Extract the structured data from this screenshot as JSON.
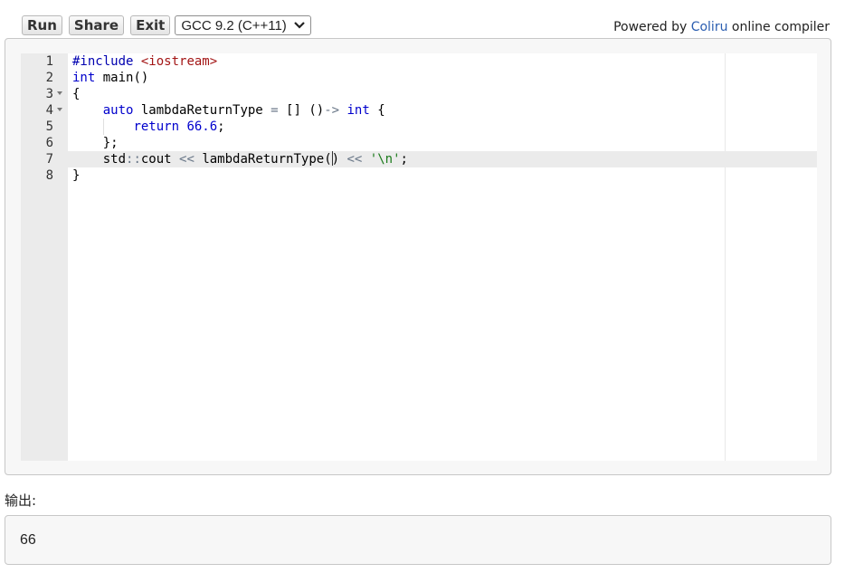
{
  "toolbar": {
    "run_label": "Run",
    "share_label": "Share",
    "exit_label": "Exit",
    "compiler_select": "GCC 9.2 (C++11)"
  },
  "powered_by": {
    "prefix": "Powered by",
    "link": "Coliru",
    "suffix": "online compiler"
  },
  "editor": {
    "active_line": 7,
    "line_numbers": [
      "1",
      "2",
      "3",
      "4",
      "5",
      "6",
      "7",
      "8"
    ],
    "lines": {
      "l1": {
        "directive": "#include",
        "header": "<iostream>"
      },
      "l2": {
        "type": "int",
        "rest": "main()"
      },
      "l3": {
        "text": "{"
      },
      "l4": {
        "kw_auto": "auto",
        "name": "lambdaReturnType",
        "eq": "=",
        "capture": "[]",
        "params": "()",
        "arrow": "->",
        "ret_type": "int",
        "brace": "{"
      },
      "l5": {
        "kw_return": "return",
        "number": "66.6",
        "semi": ";"
      },
      "l6": {
        "text": "};"
      },
      "l7": {
        "stream": "std",
        "scope": "::",
        "cout": "cout",
        "shift1": "<<",
        "call_name": "lambdaReturnType",
        "paren_open": "(",
        "paren_close": ")",
        "shift2": "<<",
        "char_lit": "'\\n'",
        "semi": ";"
      },
      "l8": {
        "text": "}"
      }
    }
  },
  "output": {
    "label": "输出:",
    "value": "66"
  },
  "colors": {
    "keyword": "#0000cc",
    "preprocessor": "#0000b0",
    "include_header": "#a31515",
    "string": "#1a7a1a",
    "operator": "#687687",
    "link": "#2a5db0"
  }
}
